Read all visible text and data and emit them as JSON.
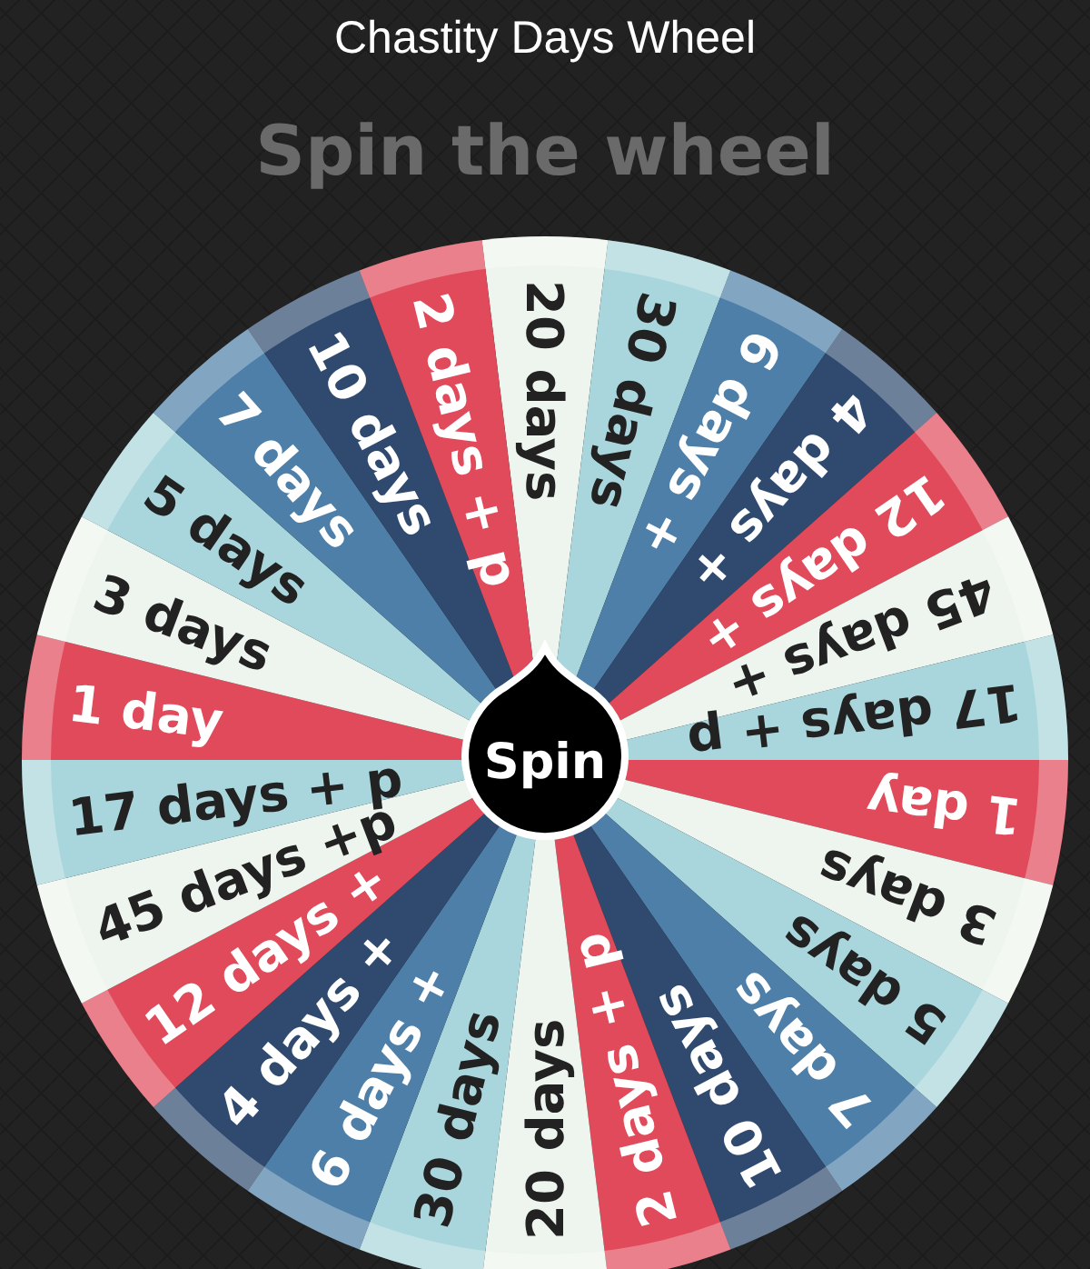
{
  "header": {
    "title": "Chastity Days Wheel"
  },
  "heading": "Spin the wheel",
  "wheel": {
    "button": "Spin",
    "segments": [
      {
        "label": "20 days",
        "color": "#eef5ee"
      },
      {
        "label": "30 days",
        "color": "#a9d6dc"
      },
      {
        "label": "6 days +",
        "color": "#4d7fa8"
      },
      {
        "label": "4 days +",
        "color": "#2f4a6e"
      },
      {
        "label": "12 days +",
        "color": "#e04a5a"
      },
      {
        "label": "45 days +",
        "color": "#eef5ee"
      },
      {
        "label": "17 days + p",
        "color": "#a9d6dc"
      },
      {
        "label": "1 day",
        "color": "#e04a5a"
      },
      {
        "label": "3 days",
        "color": "#eef5ee"
      },
      {
        "label": "5 days",
        "color": "#a9d6dc"
      },
      {
        "label": "7 days",
        "color": "#4d7fa8"
      },
      {
        "label": "10 days",
        "color": "#2f4a6e"
      },
      {
        "label": "2 days + p",
        "color": "#e04a5a"
      },
      {
        "label": "20 days",
        "color": "#eef5ee"
      },
      {
        "label": "30 days",
        "color": "#a9d6dc"
      },
      {
        "label": "6 days +",
        "color": "#4d7fa8"
      },
      {
        "label": "4 days +",
        "color": "#2f4a6e"
      },
      {
        "label": "12 days +",
        "color": "#e04a5a"
      },
      {
        "label": "45 days +p",
        "color": "#eef5ee"
      },
      {
        "label": "17 days + p",
        "color": "#a9d6dc"
      },
      {
        "label": "1 day",
        "color": "#e04a5a"
      },
      {
        "label": "3 days",
        "color": "#eef5ee"
      },
      {
        "label": "5 days",
        "color": "#a9d6dc"
      },
      {
        "label": "7 days",
        "color": "#4d7fa8"
      },
      {
        "label": "10 days",
        "color": "#2f4a6e"
      },
      {
        "label": "2 days + p",
        "color": "#e04a5a"
      }
    ]
  }
}
